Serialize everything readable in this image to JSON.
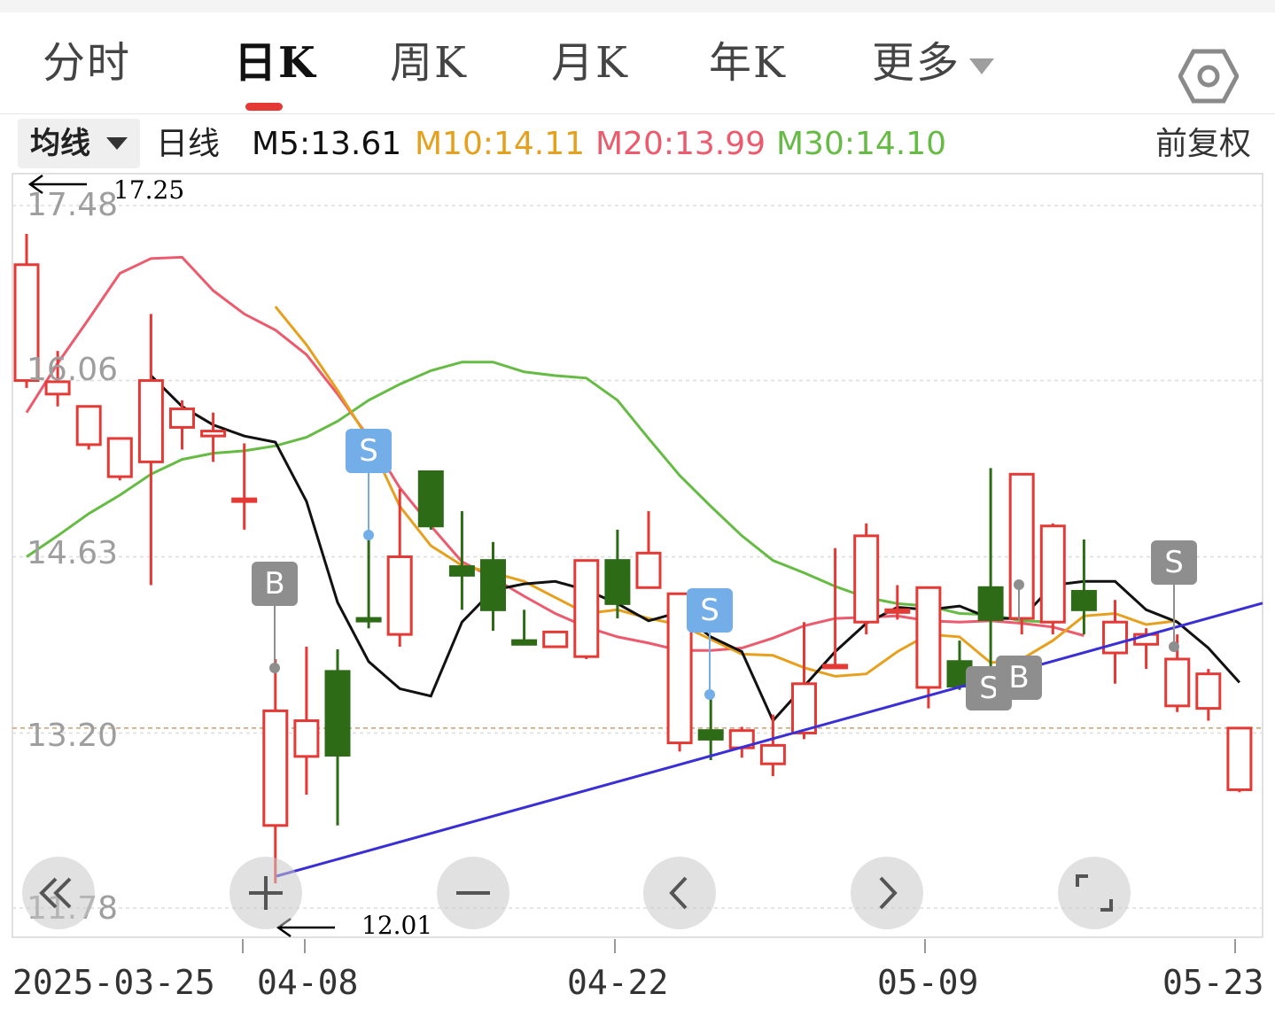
{
  "tabs": [
    {
      "label": "分时",
      "active": false
    },
    {
      "label": "日K",
      "active": true
    },
    {
      "label": "周K",
      "active": false
    },
    {
      "label": "月K",
      "active": false
    },
    {
      "label": "年K",
      "active": false
    },
    {
      "label": "更多",
      "active": false
    }
  ],
  "ma_bar": {
    "selector_label": "均线",
    "period_label": "日线",
    "m5": "M5:13.61",
    "m10": "M10:14.11",
    "m20": "M20:13.99",
    "m30": "M30:14.10",
    "adjust_label": "前复权"
  },
  "colors": {
    "m5": "#111111",
    "m10": "#e6a01e",
    "m20": "#ec5a6e",
    "m30": "#66bb44",
    "up": "#e53935",
    "down": "#2e6b17",
    "trendline": "#3a2ed6",
    "active_tab": "#e53935"
  },
  "y_axis": {
    "ticks": [
      "17.48",
      "16.06",
      "14.63",
      "13.20",
      "11.78"
    ]
  },
  "annotations": {
    "high": "17.25",
    "low": "12.01"
  },
  "x_axis": {
    "labels": [
      "2025-03-25",
      "04-08",
      "04-22",
      "05-09",
      "05-23"
    ]
  },
  "controls": [
    {
      "name": "scroll-left-fast-button",
      "icon": "double-chevron-left-icon"
    },
    {
      "name": "zoom-in-button",
      "icon": "plus-icon"
    },
    {
      "name": "zoom-out-button",
      "icon": "minus-icon"
    },
    {
      "name": "prev-button",
      "icon": "chevron-left-icon"
    },
    {
      "name": "next-button",
      "icon": "chevron-right-icon"
    },
    {
      "name": "fullscreen-button",
      "icon": "fullscreen-icon"
    }
  ],
  "markers": {
    "s": "S",
    "b": "B"
  },
  "chart_data": {
    "type": "candlestick",
    "ylim": [
      11.78,
      17.48
    ],
    "candles": [
      {
        "o": 16.06,
        "h": 17.25,
        "l": 16.0,
        "c": 17.0
      },
      {
        "o": 15.95,
        "h": 16.3,
        "l": 15.85,
        "c": 16.05
      },
      {
        "o": 15.54,
        "h": 15.59,
        "l": 15.5,
        "c": 15.85
      },
      {
        "o": 15.28,
        "h": 15.6,
        "l": 15.25,
        "c": 15.59
      },
      {
        "o": 15.4,
        "h": 16.6,
        "l": 14.4,
        "c": 16.06
      },
      {
        "o": 15.68,
        "h": 15.9,
        "l": 15.5,
        "c": 15.83
      },
      {
        "o": 15.61,
        "h": 15.8,
        "l": 15.4,
        "c": 15.65
      },
      {
        "o": 15.08,
        "h": 15.55,
        "l": 14.85,
        "c": 15.1
      },
      {
        "o": 12.45,
        "h": 13.8,
        "l": 11.98,
        "c": 13.38
      },
      {
        "o": 13.01,
        "h": 13.9,
        "l": 12.7,
        "c": 13.3
      },
      {
        "o": 13.7,
        "h": 13.88,
        "l": 12.45,
        "c": 13.02
      },
      {
        "o": 14.13,
        "h": 14.85,
        "l": 14.05,
        "c": 14.12
      },
      {
        "o": 14.0,
        "h": 15.18,
        "l": 13.9,
        "c": 14.63
      },
      {
        "o": 15.32,
        "h": 15.3,
        "l": 14.85,
        "c": 14.88
      },
      {
        "o": 14.55,
        "h": 15.0,
        "l": 14.2,
        "c": 14.48
      },
      {
        "o": 14.6,
        "h": 14.75,
        "l": 14.03,
        "c": 14.2
      },
      {
        "o": 13.95,
        "h": 14.2,
        "l": 13.95,
        "c": 13.92
      },
      {
        "o": 13.9,
        "h": 14.0,
        "l": 13.92,
        "c": 14.02
      },
      {
        "o": 13.82,
        "h": 14.5,
        "l": 13.8,
        "c": 14.6
      },
      {
        "o": 14.6,
        "h": 14.85,
        "l": 14.13,
        "c": 14.25
      },
      {
        "o": 14.38,
        "h": 15.0,
        "l": 14.38,
        "c": 14.66
      },
      {
        "o": 13.12,
        "h": 14.33,
        "l": 13.05,
        "c": 14.33
      },
      {
        "o": 13.22,
        "h": 13.5,
        "l": 12.98,
        "c": 13.15
      },
      {
        "o": 13.08,
        "h": 13.25,
        "l": 13.0,
        "c": 13.22
      },
      {
        "o": 12.95,
        "h": 13.35,
        "l": 12.85,
        "c": 13.1
      },
      {
        "o": 13.2,
        "h": 14.1,
        "l": 13.15,
        "c": 13.6
      },
      {
        "o": 13.75,
        "h": 14.7,
        "l": 13.75,
        "c": 13.75
      },
      {
        "o": 14.1,
        "h": 14.9,
        "l": 14.0,
        "c": 14.8
      },
      {
        "o": 14.2,
        "h": 14.4,
        "l": 14.12,
        "c": 14.2
      },
      {
        "o": 13.57,
        "h": 14.35,
        "l": 13.4,
        "c": 14.38
      },
      {
        "o": 13.78,
        "h": 13.95,
        "l": 13.55,
        "c": 13.58
      },
      {
        "o": 14.38,
        "h": 15.35,
        "l": 13.55,
        "c": 14.12
      },
      {
        "o": 14.13,
        "h": 15.3,
        "l": 14.0,
        "c": 15.3
      },
      {
        "o": 14.1,
        "h": 14.9,
        "l": 14.0,
        "c": 14.88
      },
      {
        "o": 14.35,
        "h": 14.77,
        "l": 14.0,
        "c": 14.2
      },
      {
        "o": 13.85,
        "h": 14.28,
        "l": 13.6,
        "c": 14.1
      },
      {
        "o": 13.92,
        "h": 14.05,
        "l": 13.72,
        "c": 14.0
      },
      {
        "o": 13.42,
        "h": 14.0,
        "l": 13.37,
        "c": 13.8
      },
      {
        "o": 13.4,
        "h": 13.72,
        "l": 13.3,
        "c": 13.68
      },
      {
        "o": 12.74,
        "h": 13.24,
        "l": 12.72,
        "c": 13.24
      }
    ],
    "ma5": [
      null,
      null,
      16.1,
      15.85,
      15.7,
      15.61,
      15.56,
      15.08,
      14.26,
      13.78,
      13.56,
      13.5,
      14.1,
      14.36,
      14.41,
      14.43,
      14.36,
      14.25,
      14.11,
      14.18,
      13.98,
      13.86,
      13.3,
      13.58,
      13.86,
      14.09,
      14.22,
      14.2,
      14.23,
      14.13,
      14.13,
      14.4,
      14.43,
      14.43,
      14.2,
      14.1,
      13.89,
      13.61
    ],
    "ma10": [
      null,
      null,
      null,
      null,
      16.66,
      16.35,
      15.98,
      15.58,
      15.04,
      14.72,
      14.56,
      14.5,
      14.43,
      14.3,
      14.17,
      14.2,
      14.13,
      14.08,
      13.96,
      13.84,
      13.83,
      13.73,
      13.66,
      13.68,
      13.86,
      14.0,
      13.98,
      13.77,
      13.8,
      13.95,
      14.15,
      14.17,
      14.08,
      14.11
    ],
    "ma20": [
      15.8,
      16.2,
      16.56,
      16.93,
      17.05,
      17.06,
      16.79,
      16.6,
      16.47,
      16.27,
      15.95,
      15.6,
      15.19,
      14.88,
      14.59,
      14.46,
      14.31,
      14.17,
      14.06,
      13.98,
      13.93,
      13.87,
      13.87,
      13.89,
      13.97,
      14.07,
      14.13,
      14.14,
      14.15,
      14.11,
      14.1,
      14.11,
      14.09,
      14.06,
      13.99
    ],
    "ma30": [
      14.63,
      14.8,
      14.98,
      15.13,
      15.3,
      15.42,
      15.47,
      15.49,
      15.53,
      15.6,
      15.73,
      15.9,
      16.03,
      16.14,
      16.21,
      16.21,
      16.13,
      16.1,
      16.08,
      15.9,
      15.59,
      15.29,
      15.04,
      14.8,
      14.6,
      14.5,
      14.39,
      14.3,
      14.25,
      14.23,
      14.17,
      14.16,
      14.11,
      14.1
    ],
    "trendline": {
      "from": 12.01,
      "to": 14.11
    },
    "signals": [
      "S",
      "B",
      "S",
      "S",
      "B",
      "S"
    ]
  }
}
